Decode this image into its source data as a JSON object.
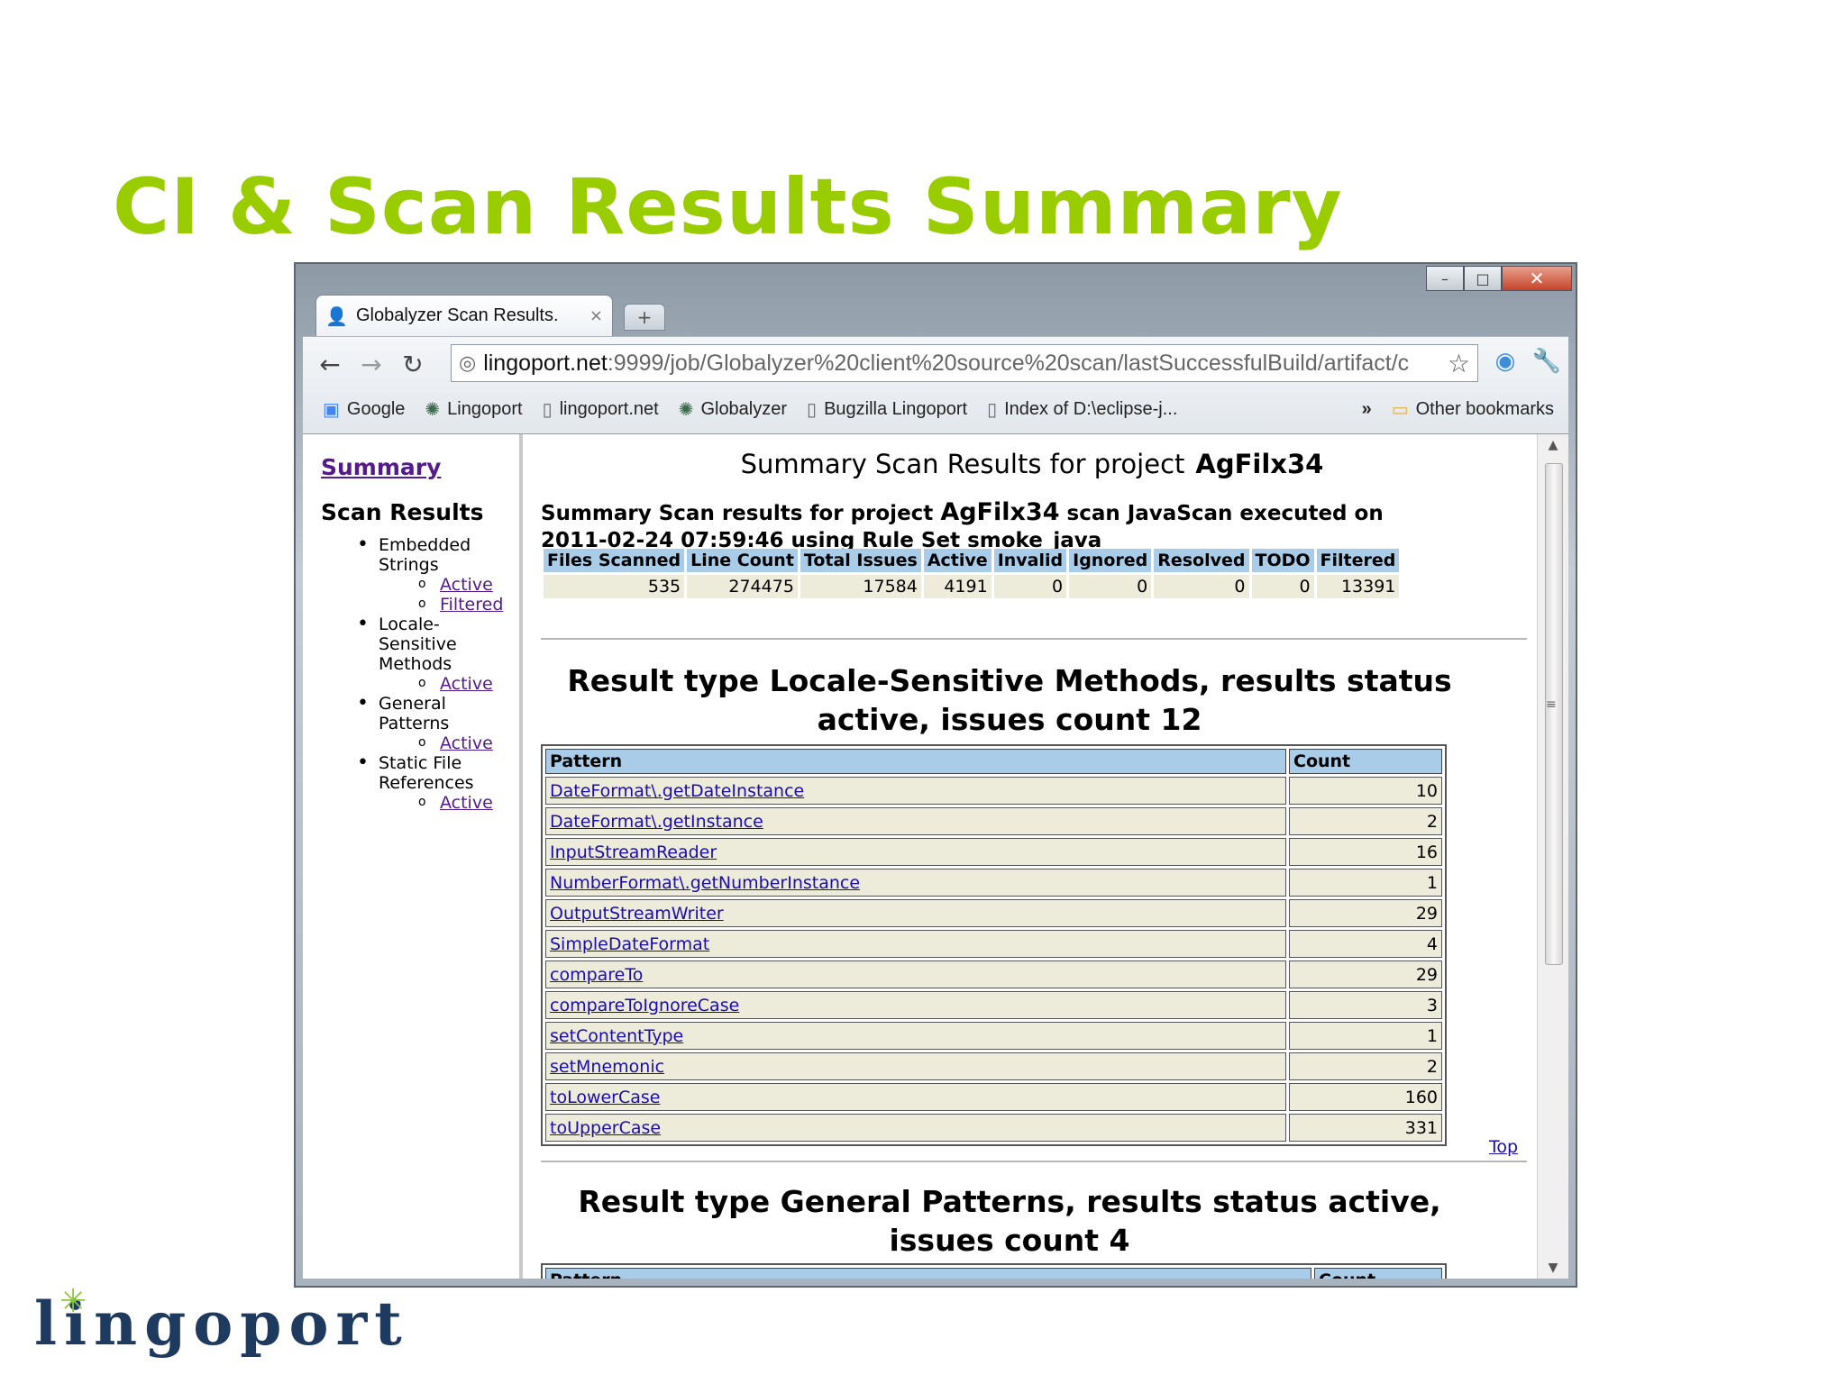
{
  "slide": {
    "title": "CI & Scan Results Summary",
    "logo_text": "lingoport"
  },
  "browser": {
    "window_controls": {
      "minimize": "–",
      "maximize": "□",
      "close": "✕"
    },
    "tab": {
      "title": "Globalyzer Scan Results.",
      "close": "×",
      "new_tab": "+"
    },
    "url_host": "lingoport.net",
    "url_rest": ":9999/job/Globalyzer%20client%20source%20scan/lastSuccessfulBuild/artifact/c",
    "bookmarks": [
      "Google",
      "Lingoport",
      "lingoport.net",
      "Globalyzer",
      "Bugzilla Lingoport",
      "Index of D:\\eclipse-j..."
    ],
    "bookmarks_more": "»",
    "other_bookmarks": "Other bookmarks"
  },
  "sidebar": {
    "summary_link": "Summary",
    "heading": "Scan Results",
    "groups": [
      {
        "label": "Embedded Strings",
        "links": [
          "Active",
          "Filtered"
        ]
      },
      {
        "label": "Locale-Sensitive Methods",
        "links": [
          "Active"
        ]
      },
      {
        "label": "General Patterns",
        "links": [
          "Active"
        ]
      },
      {
        "label": "Static File References",
        "links": [
          "Active"
        ]
      }
    ]
  },
  "page": {
    "title_prefix": "Summary Scan Results for project",
    "project": "AgFilx34",
    "scan_line_1": "Summary Scan results for project",
    "scan_line_2": "scan JavaScan executed on",
    "scan_line_3": "2011-02-24 07:59:46 using Rule Set smoke_java",
    "summary_headers": [
      "Files Scanned",
      "Line Count",
      "Total Issues",
      "Active",
      "Invalid",
      "Ignored",
      "Resolved",
      "TODO",
      "Filtered"
    ],
    "summary_values": [
      "535",
      "274475",
      "17584",
      "4191",
      "0",
      "0",
      "0",
      "0",
      "13391"
    ],
    "section1_title": "Result type Locale-Sensitive Methods, results status active, issues count 12",
    "pattern_header": "Pattern",
    "count_header": "Count",
    "section1_rows": [
      {
        "pattern": "DateFormat\\.getDateInstance",
        "count": "10"
      },
      {
        "pattern": "DateFormat\\.getInstance",
        "count": "2"
      },
      {
        "pattern": "InputStreamReader",
        "count": "16"
      },
      {
        "pattern": "NumberFormat\\.getNumberInstance",
        "count": "1"
      },
      {
        "pattern": "OutputStreamWriter",
        "count": "29"
      },
      {
        "pattern": "SimpleDateFormat",
        "count": "4"
      },
      {
        "pattern": "compareTo",
        "count": "29"
      },
      {
        "pattern": "compareToIgnoreCase",
        "count": "3"
      },
      {
        "pattern": "setContentType",
        "count": "1"
      },
      {
        "pattern": "setMnemonic",
        "count": "2"
      },
      {
        "pattern": "toLowerCase",
        "count": "160"
      },
      {
        "pattern": "toUpperCase",
        "count": "331"
      }
    ],
    "top_link": "Top",
    "section2_title": "Result type General Patterns, results status active, issues count 4"
  },
  "colors": {
    "title_green": "#9acd00",
    "table_header_blue": "#a9cce8",
    "table_cell_beige": "#edebd9",
    "visited_link": "#551a8b",
    "link": "#1a0dab",
    "logo_navy": "#1f3a5f"
  }
}
